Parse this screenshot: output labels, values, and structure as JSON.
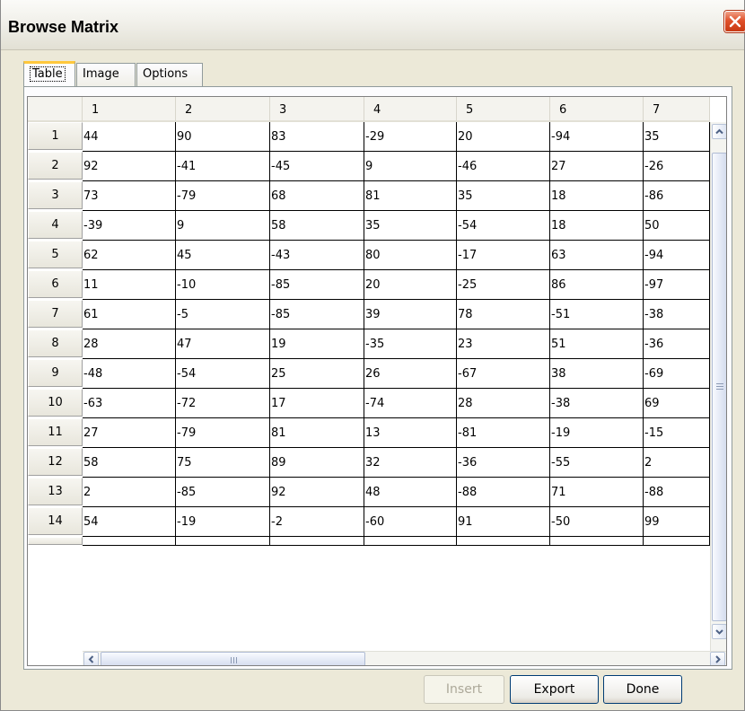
{
  "window": {
    "title": "Browse Matrix"
  },
  "tabs": [
    {
      "label": "Table",
      "active": true
    },
    {
      "label": "Image",
      "active": false
    },
    {
      "label": "Options",
      "active": false
    }
  ],
  "table": {
    "columns": [
      "1",
      "2",
      "3",
      "4",
      "5",
      "6",
      "7"
    ],
    "rows": [
      {
        "label": "1",
        "cells": [
          "44",
          "90",
          "83",
          "-29",
          "20",
          "-94",
          "35"
        ]
      },
      {
        "label": "2",
        "cells": [
          "92",
          "-41",
          "-45",
          "9",
          "-46",
          "27",
          "-26"
        ]
      },
      {
        "label": "3",
        "cells": [
          "73",
          "-79",
          "68",
          "81",
          "35",
          "18",
          "-86"
        ]
      },
      {
        "label": "4",
        "cells": [
          "-39",
          "9",
          "58",
          "35",
          "-54",
          "18",
          "50"
        ]
      },
      {
        "label": "5",
        "cells": [
          "62",
          "45",
          "-43",
          "80",
          "-17",
          "63",
          "-94"
        ]
      },
      {
        "label": "6",
        "cells": [
          "11",
          "-10",
          "-85",
          "20",
          "-25",
          "86",
          "-97"
        ]
      },
      {
        "label": "7",
        "cells": [
          "61",
          "-5",
          "-85",
          "39",
          "78",
          "-51",
          "-38"
        ]
      },
      {
        "label": "8",
        "cells": [
          "28",
          "47",
          "19",
          "-35",
          "23",
          "51",
          "-36"
        ]
      },
      {
        "label": "9",
        "cells": [
          "-48",
          "-54",
          "25",
          "26",
          "-67",
          "38",
          "-69"
        ]
      },
      {
        "label": "10",
        "cells": [
          "-63",
          "-72",
          "17",
          "-74",
          "28",
          "-38",
          "69"
        ]
      },
      {
        "label": "11",
        "cells": [
          "27",
          "-79",
          "81",
          "13",
          "-81",
          "-19",
          "-15"
        ]
      },
      {
        "label": "12",
        "cells": [
          "58",
          "75",
          "89",
          "32",
          "-36",
          "-55",
          "2"
        ]
      },
      {
        "label": "13",
        "cells": [
          "2",
          "-85",
          "92",
          "48",
          "-88",
          "71",
          "-88"
        ]
      },
      {
        "label": "14",
        "cells": [
          "54",
          "-19",
          "-2",
          "-60",
          "91",
          "-50",
          "99"
        ]
      }
    ]
  },
  "buttons": {
    "insert": {
      "label": "Insert",
      "enabled": false
    },
    "export": {
      "label": "Export"
    },
    "done": {
      "label": "Done"
    }
  },
  "icons": {
    "close": "close-x-icon",
    "scroll_up": "arrow-up-icon",
    "scroll_down": "arrow-down-icon",
    "scroll_left": "arrow-left-icon",
    "scroll_right": "arrow-right-icon"
  },
  "colors": {
    "window_bg": "#ece9d8",
    "active_tab_highlight": "#ffc83c",
    "close_button": "#e0502a",
    "disabled_text": "#aca899"
  }
}
